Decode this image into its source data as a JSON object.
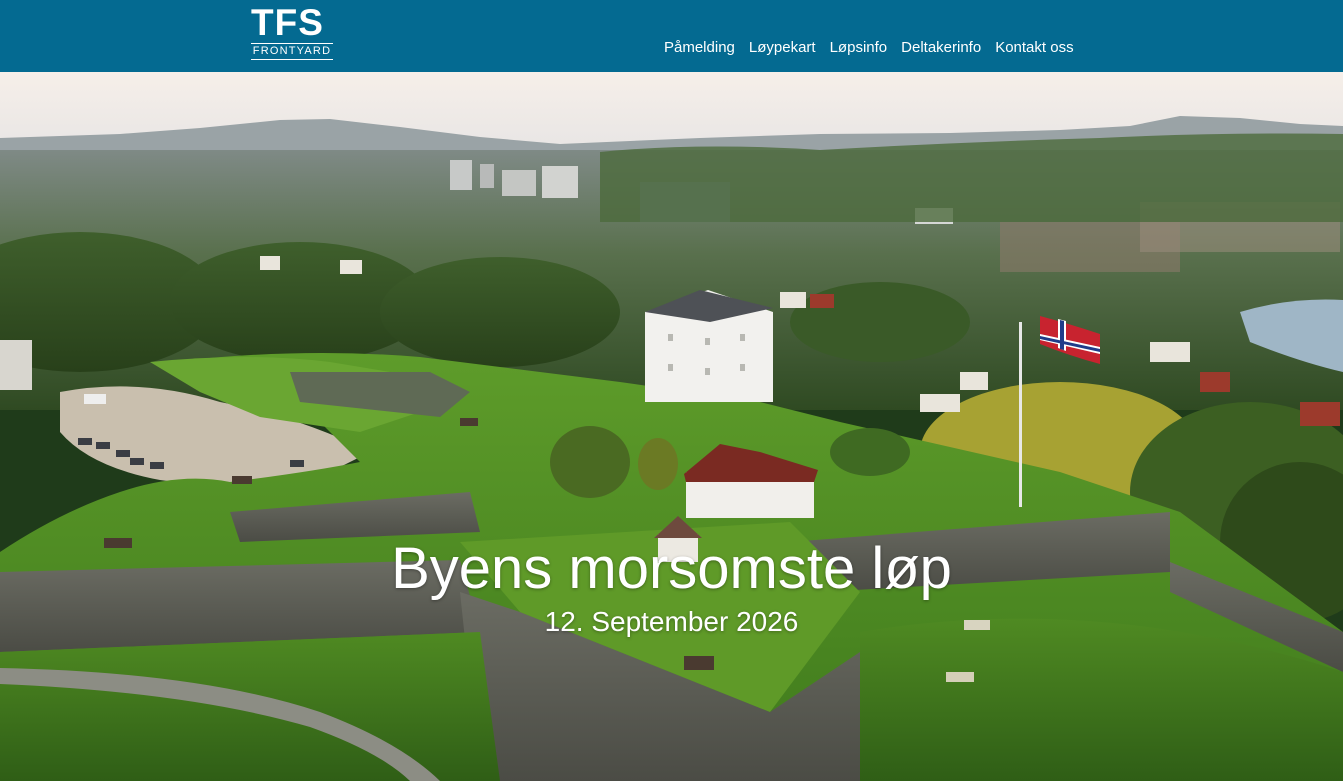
{
  "brand": {
    "logo_text": "TFS",
    "logo_subtext": "FRONTYARD"
  },
  "nav": {
    "items": [
      {
        "label": "Påmelding"
      },
      {
        "label": "Løypekart"
      },
      {
        "label": "Løpsinfo"
      },
      {
        "label": "Deltakerinfo"
      },
      {
        "label": "Kontakt oss"
      }
    ]
  },
  "hero": {
    "title": "Byens morsomste løp",
    "date": "12. September 2026",
    "image": "aerial-fortress-city-photo"
  },
  "colors": {
    "header_bg": "#046a91",
    "text": "#ffffff"
  }
}
